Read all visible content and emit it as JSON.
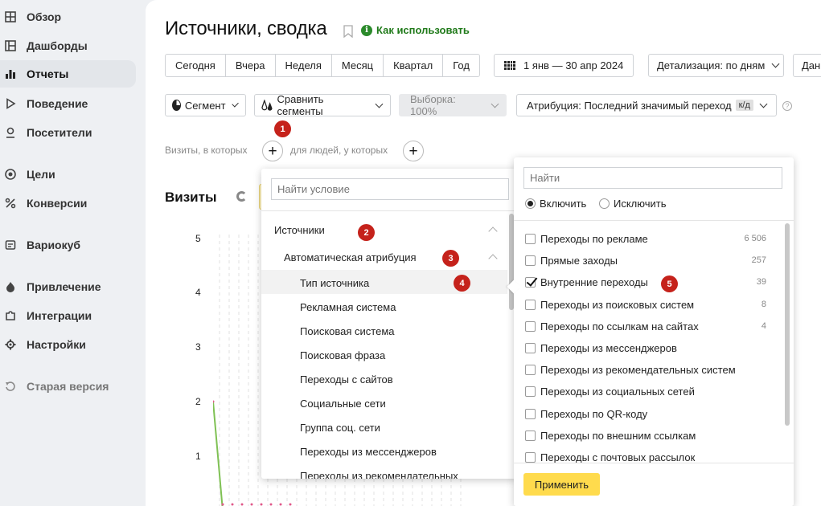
{
  "sidebar": {
    "items": [
      {
        "label": "Обзор",
        "icon": "grid-icon"
      },
      {
        "label": "Дашборды",
        "icon": "dashboard-icon"
      },
      {
        "label": "Отчеты",
        "icon": "bar-chart-icon",
        "active": true
      },
      {
        "label": "Поведение",
        "icon": "play-icon"
      },
      {
        "label": "Посетители",
        "icon": "user-icon"
      },
      {
        "label": "Цели",
        "icon": "target-icon"
      },
      {
        "label": "Конверсии",
        "icon": "percent-icon"
      },
      {
        "label": "Вариокуб",
        "icon": "cube-icon"
      },
      {
        "label": "Привлечение",
        "icon": "flame-icon"
      },
      {
        "label": "Интеграции",
        "icon": "puzzle-icon"
      },
      {
        "label": "Настройки",
        "icon": "gear-icon"
      },
      {
        "label": "Старая версия",
        "icon": "undo-icon"
      }
    ]
  },
  "header": {
    "title": "Источники, сводка",
    "how_to": "Как использовать"
  },
  "periods": [
    "Сегодня",
    "Вчера",
    "Неделя",
    "Месяц",
    "Квартал",
    "Год"
  ],
  "date_range": "1 янв — 30 апр 2024",
  "detail": "Детализация: по дням",
  "cut_button": "Дан",
  "controls": {
    "segment": "Сегмент",
    "compare": "Сравнить сегменты",
    "sample": "Выборка: 100%",
    "attribution": "Атрибуция: Последний значимый переход",
    "attribution_badge": "к/д"
  },
  "segment_builder": {
    "visits_label": "Визиты, в которых",
    "people_label": "для людей, у которых"
  },
  "chart": {
    "title": "Визиты"
  },
  "chart_data": {
    "type": "line",
    "title": "Визиты",
    "ylim": [
      0,
      5
    ],
    "y_ticks": [
      1,
      2,
      3,
      4,
      5
    ],
    "series": [
      {
        "values": [
          2,
          0,
          0,
          0,
          0,
          0,
          0,
          0,
          0
        ]
      }
    ],
    "grid": true
  },
  "condition_dropdown": {
    "search_placeholder": "Найти условие",
    "group": "Источники",
    "subgroup": "Автоматическая атрибуция",
    "items": [
      "Тип источника",
      "Рекламная система",
      "Поисковая система",
      "Поисковая фраза",
      "Переходы с сайтов",
      "Социальные сети",
      "Группа соц. сети",
      "Переходы из мессенджеров",
      "Переходы из рекомендательных"
    ],
    "selected_index": 0
  },
  "value_dropdown": {
    "search_placeholder": "Найти",
    "include": "Включить",
    "exclude": "Исключить",
    "items": [
      {
        "label": "Переходы по рекламе",
        "count": "6 506",
        "checked": false
      },
      {
        "label": "Прямые заходы",
        "count": "257",
        "checked": false
      },
      {
        "label": "Внутренние переходы",
        "count": "39",
        "checked": true
      },
      {
        "label": "Переходы из поисковых систем",
        "count": "8",
        "checked": false
      },
      {
        "label": "Переходы по ссылкам на сайтах",
        "count": "4",
        "checked": false
      },
      {
        "label": "Переходы из мессенджеров",
        "count": "",
        "checked": false
      },
      {
        "label": "Переходы из рекомендательных систем",
        "count": "",
        "checked": false
      },
      {
        "label": "Переходы из социальных сетей",
        "count": "",
        "checked": false
      },
      {
        "label": "Переходы по QR-коду",
        "count": "",
        "checked": false
      },
      {
        "label": "Переходы по внешним ссылкам",
        "count": "",
        "checked": false
      },
      {
        "label": "Переходы с почтовых рассылок",
        "count": "",
        "checked": false
      }
    ],
    "apply": "Применить"
  },
  "badges": [
    "1",
    "2",
    "3",
    "4",
    "5"
  ]
}
